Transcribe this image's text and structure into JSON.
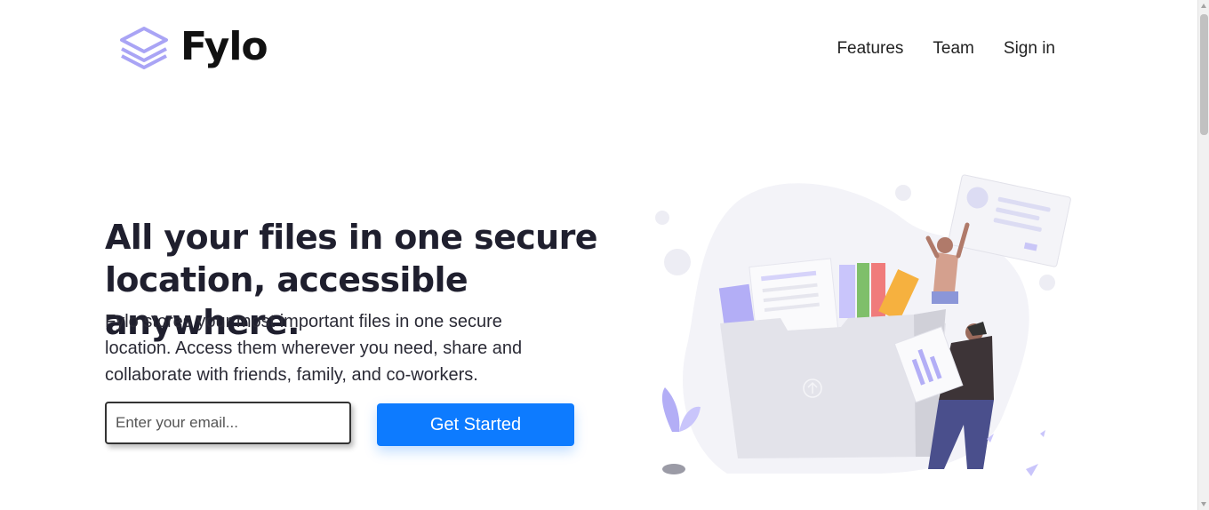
{
  "brand": {
    "name": "Fylo",
    "icon": "stacked-layers-icon",
    "icon_color": "#a9a4f5"
  },
  "nav": {
    "items": [
      {
        "label": "Features"
      },
      {
        "label": "Team"
      },
      {
        "label": "Sign in"
      }
    ]
  },
  "hero": {
    "title": "All your files in one secure location, accessible anywhere.",
    "description": "Fylo stores your most important files in one secure location. Access them wherever you need, share and collaborate with friends, family, and co-workers."
  },
  "signup": {
    "email_placeholder": "Enter your email...",
    "email_value": "",
    "button_label": "Get Started"
  },
  "colors": {
    "accent": "#0d7bff",
    "text_dark": "#1f1f2e"
  },
  "illustration": {
    "icon": "file-sharing-illustration"
  }
}
